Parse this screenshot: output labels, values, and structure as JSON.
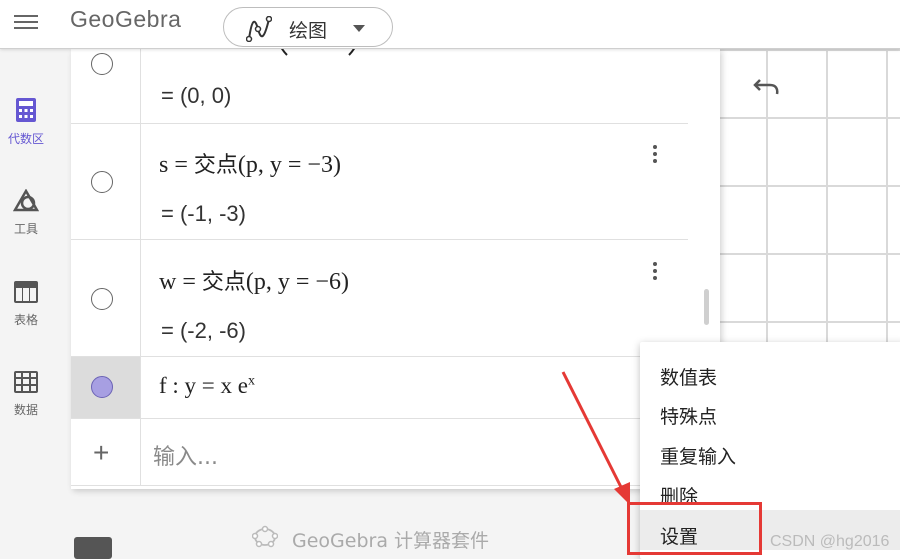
{
  "header": {
    "logo_text": "GeoGebra",
    "app_picker_label": "绘图"
  },
  "sidebar": {
    "items": [
      {
        "label": "代数区",
        "icon": "calculator-icon",
        "active": true
      },
      {
        "label": "工具",
        "icon": "shapes-icon",
        "active": false
      },
      {
        "label": "表格",
        "icon": "table-icon",
        "active": false
      },
      {
        "label": "数据",
        "icon": "spreadsheet-icon",
        "active": false
      }
    ]
  },
  "algebra": {
    "rows": [
      {
        "definition": "",
        "value": "= (0, 0)",
        "visible": false
      },
      {
        "definition_name": "s",
        "definition_func": "交点",
        "definition_args": "(p, y = −3)",
        "value": "= (-1, -3)",
        "visible": false
      },
      {
        "definition_name": "w",
        "definition_func": "交点",
        "definition_args": "(p, y = −6)",
        "value": "= (-2, -6)",
        "visible": false
      },
      {
        "definition": "f : y = x e",
        "exponent": "x",
        "visible": true
      }
    ],
    "input_placeholder": "输入..."
  },
  "footer": {
    "suite_text": "GeoGebra 计算器套件"
  },
  "context_menu": {
    "items": [
      "数值表",
      "特殊点",
      "重复输入",
      "删除",
      "设置"
    ],
    "highlighted": "设置"
  },
  "watermark": "CSDN @hg2016",
  "colors": {
    "accent": "#6557d2",
    "marble_on": "#a79fe2",
    "annotation": "#e53935"
  }
}
